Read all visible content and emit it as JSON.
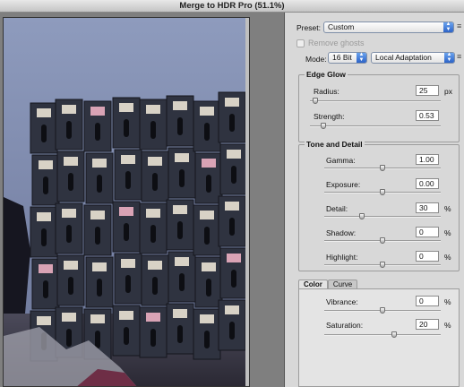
{
  "window": {
    "title": "Merge to HDR Pro (51.1%)"
  },
  "preset": {
    "label": "Preset:",
    "value": "Custom"
  },
  "remove_ghosts": {
    "label": "Remove ghosts",
    "checked": false
  },
  "mode": {
    "label": "Mode:",
    "bit_depth": "16 Bit",
    "method": "Local Adaptation"
  },
  "edge_glow": {
    "title": "Edge Glow",
    "radius": {
      "label": "Radius:",
      "value": "25",
      "unit": "px",
      "level": 0.04
    },
    "strength": {
      "label": "Strength:",
      "value": "0.53",
      "unit": "",
      "level": 0.1
    }
  },
  "tone_detail": {
    "title": "Tone and Detail",
    "gamma": {
      "label": "Gamma:",
      "value": "1.00",
      "unit": "",
      "level": 0.5
    },
    "exposure": {
      "label": "Exposure:",
      "value": "0.00",
      "unit": "",
      "level": 0.5
    },
    "detail": {
      "label": "Detail:",
      "value": "30",
      "unit": "%",
      "level": 0.32
    },
    "shadow": {
      "label": "Shadow:",
      "value": "0",
      "unit": "%",
      "level": 0.5
    },
    "highlight": {
      "label": "Highlight:",
      "value": "0",
      "unit": "%",
      "level": 0.5
    }
  },
  "tabs": {
    "color": "Color",
    "curve": "Curve"
  },
  "color": {
    "vibrance": {
      "label": "Vibrance:",
      "value": "0",
      "unit": "%",
      "level": 0.5
    },
    "saturation": {
      "label": "Saturation:",
      "value": "20",
      "unit": "%",
      "level": 0.6
    }
  },
  "icons": {
    "panel_menu": "panel-menu-icon",
    "select_arrows": "select-arrows-icon"
  }
}
